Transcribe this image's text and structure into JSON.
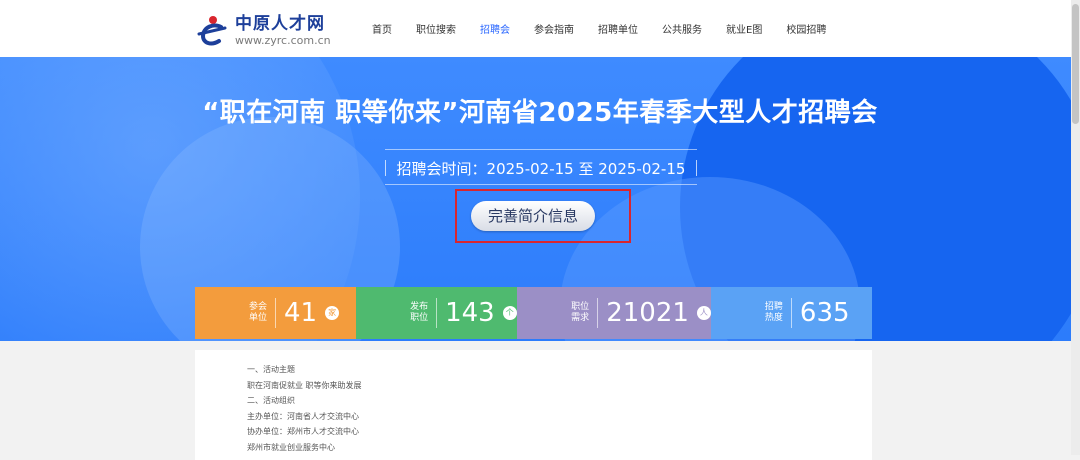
{
  "header": {
    "logo_name": "中原人才网",
    "logo_url": "www.zyrc.com.cn",
    "nav": [
      {
        "label": "首页",
        "active": false
      },
      {
        "label": "职位搜索",
        "active": false
      },
      {
        "label": "招聘会",
        "active": true
      },
      {
        "label": "参会指南",
        "active": false
      },
      {
        "label": "招聘单位",
        "active": false
      },
      {
        "label": "公共服务",
        "active": false
      },
      {
        "label": "就业E图",
        "active": false
      },
      {
        "label": "校园招聘",
        "active": false
      }
    ]
  },
  "banner": {
    "title": "“职在河南 职等你来”河南省2025年春季大型人才招聘会",
    "date_text": "招聘会时间：2025-02-15 至 2025-02-15",
    "profile_button": "完善简介信息"
  },
  "stats": [
    {
      "label": "参会单位",
      "value": "41",
      "unit": "家",
      "color": "#f39c3d"
    },
    {
      "label": "发布职位",
      "value": "143",
      "unit": "个",
      "color": "#4fba6f"
    },
    {
      "label": "职位需求",
      "value": "21021",
      "unit": "人",
      "color": "#9b8fc6"
    },
    {
      "label": "招聘热度",
      "value": "635",
      "unit": "",
      "color": "#5aa2f5"
    }
  ],
  "content": {
    "lines": [
      "一、活动主题",
      "职在河南促就业 职等你来助发展",
      "二、活动组织",
      "主办单位：河南省人才交流中心",
      "协办单位：郑州市人才交流中心",
      "郑州市就业创业服务中心"
    ]
  },
  "colors": {
    "brand": "#1d3f9a",
    "nav_active": "#2a67ff",
    "banner": "#2c7cfb",
    "highlight": "#d9262e"
  }
}
